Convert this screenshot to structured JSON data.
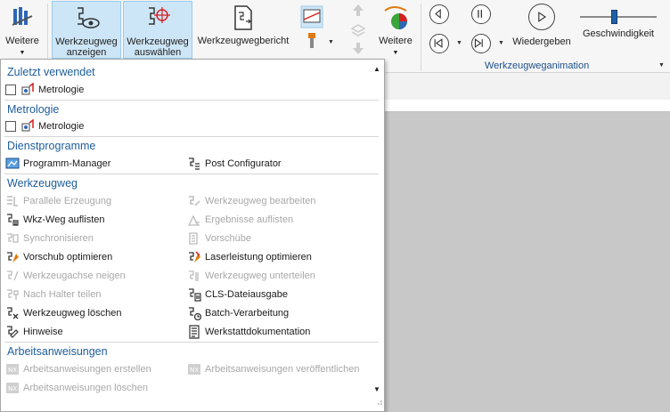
{
  "ribbon": {
    "weitere_left": "Weitere",
    "anzeigen_line1": "Werkzeugweg",
    "anzeigen_line2": "anzeigen",
    "auswaehlen_line1": "Werkzeugweg",
    "auswaehlen_line2": "auswählen",
    "bericht": "Werkzeugwegbericht",
    "weitere_right": "Weitere",
    "wiedergeben": "Wiedergeben",
    "geschwindigkeit": "Geschwindigkeit",
    "group_animation": "Werkzeugweganimation",
    "speed_level": 0.45
  },
  "menu": {
    "sections": [
      {
        "title": "Zuletzt verwendet",
        "items": [
          {
            "label": "Metrologie",
            "checkbox": true,
            "disabled": false
          }
        ]
      },
      {
        "title": "Metrologie",
        "items": [
          {
            "label": "Metrologie",
            "checkbox": true,
            "disabled": false
          }
        ]
      },
      {
        "title": "Dienstprogramme",
        "items": [
          {
            "label": "Programm-Manager",
            "disabled": false
          },
          {
            "label": "Post Configurator",
            "disabled": false
          }
        ]
      },
      {
        "title": "Werkzeugweg",
        "left": [
          {
            "label": "Parallele Erzeugung",
            "disabled": true
          },
          {
            "label": "Wkz-Weg auflisten",
            "disabled": false
          },
          {
            "label": "Synchronisieren",
            "disabled": true
          },
          {
            "label": "Vorschub optimieren",
            "disabled": false
          },
          {
            "label": "Werkzeugachse neigen",
            "disabled": true
          },
          {
            "label": "Nach Halter teilen",
            "disabled": true
          },
          {
            "label": "Werkzeugweg löschen",
            "disabled": false
          },
          {
            "label": "Hinweise",
            "disabled": false
          }
        ],
        "right": [
          {
            "label": "Werkzeugweg bearbeiten",
            "disabled": true
          },
          {
            "label": "Ergebnisse auflisten",
            "disabled": true
          },
          {
            "label": "Vorschübe",
            "disabled": true
          },
          {
            "label": "Laserleistung optimieren",
            "disabled": false
          },
          {
            "label": "Werkzeugweg unterteilen",
            "disabled": true
          },
          {
            "label": "CLS-Dateiausgabe",
            "disabled": false
          },
          {
            "label": "Batch-Verarbeitung",
            "disabled": false
          },
          {
            "label": "Werkstattdokumentation",
            "disabled": false
          }
        ]
      },
      {
        "title": "Arbeitsanweisungen",
        "left": [
          {
            "label": "Arbeitsanweisungen erstellen",
            "disabled": true
          },
          {
            "label": "Arbeitsanweisungen löschen",
            "disabled": true
          }
        ],
        "right": [
          {
            "label": "Arbeitsanweisungen veröffentlichen",
            "disabled": true
          }
        ]
      }
    ]
  },
  "colors": {
    "section_title": "#1d5d9b",
    "selected_bg": "#cde6f7",
    "disabled_text": "#a8a8a8",
    "accent_orange": "#e07a10",
    "accent_red": "#d42020"
  }
}
